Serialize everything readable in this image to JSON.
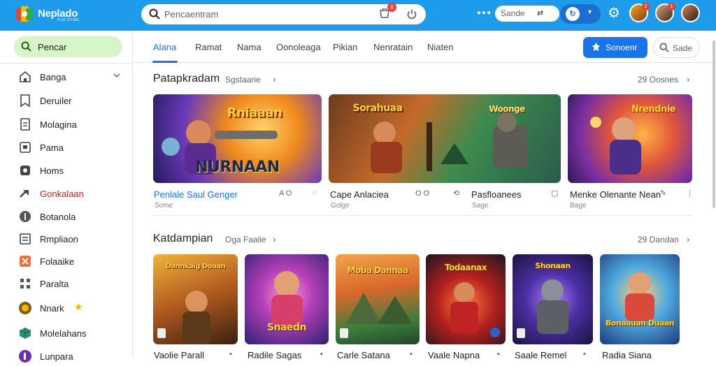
{
  "app": {
    "brand": "Neplado",
    "brand_sub": "PLAY STORE"
  },
  "search": {
    "placeholder": "Pencaentram",
    "cart_count": "8"
  },
  "topbar": {
    "pill_text": "Sande",
    "notify": [
      "2",
      "1"
    ]
  },
  "side_search_label": "Pencar",
  "sidebar": {
    "items": [
      {
        "label": "Banga",
        "icon": "home-icon"
      },
      {
        "label": "Deruiler",
        "icon": "bookmark-icon"
      },
      {
        "label": "Molagina",
        "icon": "document-icon"
      },
      {
        "label": "Pama",
        "icon": "flag-icon"
      },
      {
        "label": "Homs",
        "icon": "settings-icon"
      },
      {
        "label": "Gonkalaan",
        "icon": "arrow-icon"
      },
      {
        "label": "Botanola",
        "icon": "shield-icon"
      },
      {
        "label": "Rmpliaon",
        "icon": "list-icon"
      },
      {
        "label": "Folaaike",
        "icon": "fire-icon"
      },
      {
        "label": "Paralta",
        "icon": "grid-icon"
      },
      {
        "label": "Nnark",
        "icon": "medal-icon"
      },
      {
        "label": "Molelahans",
        "icon": "cube-icon"
      },
      {
        "label": "Lunpara",
        "icon": "badge-icon"
      }
    ]
  },
  "tabs": [
    {
      "label": "Alana"
    },
    {
      "label": "Ramat"
    },
    {
      "label": "Nama"
    },
    {
      "label": "Oonoleaga"
    },
    {
      "label": "Pikian"
    },
    {
      "label": "Nenratain"
    },
    {
      "label": "Niaten"
    }
  ],
  "buttons": {
    "primary": "Sonoenr",
    "secondary": "Sade"
  },
  "section1": {
    "title": "Patapkradam",
    "sub": "Sgstaarie",
    "right": "29 Oosnes",
    "cards": [
      {
        "art_title": "Rniaaan",
        "art_bottom": "NURNAAN",
        "title": "Penlale Saul Genger",
        "sub": "Some",
        "meta": "A O"
      },
      {
        "art_title": "Sorahuaa",
        "art_title2": "Woonge",
        "title": "Cape Anlaciea",
        "sub": "Golge",
        "meta": "O O"
      },
      {
        "title": "Pasfloanees",
        "sub": "Sage"
      },
      {
        "art_title": "Nrendnie",
        "title": "Menke Olenante Nean",
        "sub": "Bage"
      }
    ]
  },
  "section2": {
    "title": "Katdampian",
    "sub": "Oga Faalie",
    "right": "29 Dandan",
    "tiles": [
      {
        "art_title": "Dannkaig Doaan",
        "title": "Vaolie Parall"
      },
      {
        "art_title": "Snaedn",
        "title": "Radile Sagas"
      },
      {
        "art_title": "Moba Dannaa",
        "title": "Carle Satana"
      },
      {
        "art_title": "Todaanax",
        "title": "Vaale Napna"
      },
      {
        "art_title": "Shonaan",
        "title": "Saale Remel"
      },
      {
        "art_title": "Bonaauan Duaan",
        "title": "Radia Siana"
      }
    ]
  },
  "colors": {
    "topbar": "#1e9bea",
    "accent": "#1a73e8",
    "side_search_bg": "#d8f5c9"
  }
}
